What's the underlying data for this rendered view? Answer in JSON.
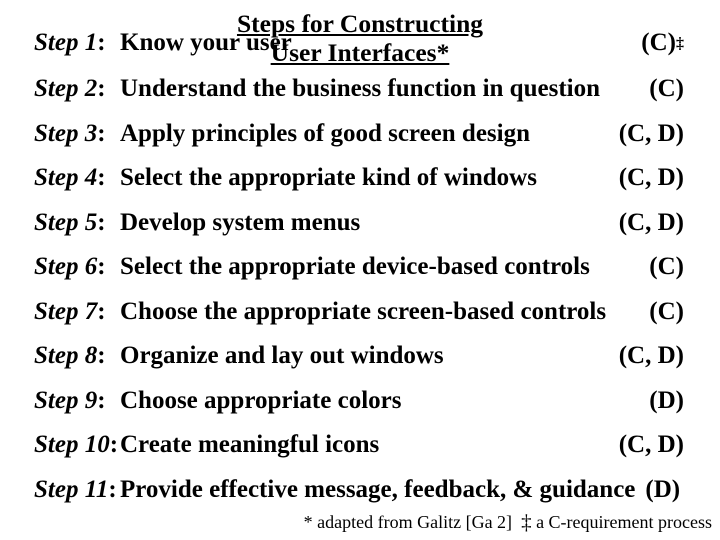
{
  "title_line1": "Steps for Constructing",
  "title_line2": "User Interfaces*",
  "steps": [
    {
      "num": "Step 1",
      "text": "Know your user",
      "tag": "(C)",
      "dagger": "‡"
    },
    {
      "num": "Step 2",
      "text": "Understand the business function in question",
      "tag": "(C)",
      "dagger": ""
    },
    {
      "num": "Step 3",
      "text": "Apply principles of good screen design",
      "tag": "(C, D)",
      "dagger": ""
    },
    {
      "num": "Step 4",
      "text": "Select the appropriate kind of windows",
      "tag": "(C, D)",
      "dagger": ""
    },
    {
      "num": "Step 5",
      "text": "Develop system menus",
      "tag": "(C, D)",
      "dagger": ""
    },
    {
      "num": "Step 6",
      "text": "Select the appropriate device-based controls",
      "tag": "(C)",
      "dagger": ""
    },
    {
      "num": "Step 7",
      "text": "Choose the appropriate screen-based controls",
      "tag": "(C)",
      "dagger": ""
    },
    {
      "num": "Step 8",
      "text": "Organize and lay out windows",
      "tag": "(C, D)",
      "dagger": ""
    },
    {
      "num": "Step 9",
      "text": "Choose appropriate colors",
      "tag": "(D)",
      "dagger": ""
    },
    {
      "num": "Step 10",
      "text": "Create meaningful icons",
      "tag": "(C, D)",
      "dagger": ""
    },
    {
      "num": "Step 11",
      "text": "Provide effective message, feedback, & guidance",
      "tag": "(D)",
      "dagger": "",
      "tight": true
    }
  ],
  "footnote_left": "* adapted from Galitz [Ga 2]",
  "footnote_dagger": "‡",
  "footnote_right": " a C-requirement process"
}
